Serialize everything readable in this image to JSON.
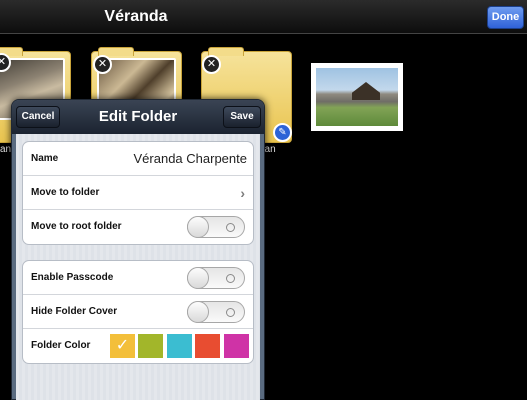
{
  "nav": {
    "title": "Véranda",
    "done_label": "Done"
  },
  "background": {
    "folder_close_glyph": "✕",
    "folder_edit_glyph": "✎",
    "caption_left": "an",
    "caption_right": "dan"
  },
  "popover": {
    "title": "Edit Folder",
    "cancel_label": "Cancel",
    "save_label": "Save",
    "name_label": "Name",
    "name_value": "Véranda Charpente",
    "move_to_folder_label": "Move to folder",
    "chevron_glyph": "›",
    "move_to_root_label": "Move to root folder",
    "move_to_root_on": false,
    "enable_passcode_label": "Enable Passcode",
    "enable_passcode_on": false,
    "hide_cover_label": "Hide Folder Cover",
    "hide_cover_on": false,
    "folder_color_label": "Folder Color",
    "selected_check": "✓",
    "colors": [
      "#f3bf3a",
      "#a2b62a",
      "#3bbdd1",
      "#e84d31",
      "#cf33a6"
    ],
    "selected_color_index": 0
  }
}
